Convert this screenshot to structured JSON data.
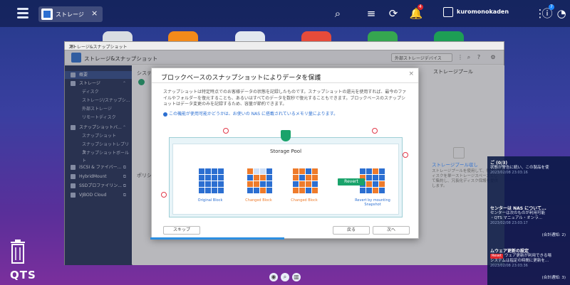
{
  "topbar": {
    "tab_label": "ストレージ",
    "user_name": "kuromonokaden",
    "notif_count": "4",
    "info_count": "7"
  },
  "dock": {
    "qts_label": "QTS"
  },
  "window": {
    "title": "ストレージ&スナップショット",
    "app_title": "ストレージ&スナップショット",
    "external_device": "外部ストレージデバイス"
  },
  "sidebar": {
    "items": [
      {
        "label": "概要",
        "level": "main"
      },
      {
        "label": "ストレージ",
        "level": "main"
      },
      {
        "label": "ディスク",
        "level": "sub"
      },
      {
        "label": "ストレージ/スナップシ...",
        "level": "sub"
      },
      {
        "label": "外部ストレージ",
        "level": "sub"
      },
      {
        "label": "リモートディスク",
        "level": "sub"
      },
      {
        "label": "スナップショットバ...",
        "level": "main"
      },
      {
        "label": "スナップショット",
        "level": "sub"
      },
      {
        "label": "スナップショットレプリカ",
        "level": "sub"
      },
      {
        "label": "スナップショットボールト",
        "level": "sub"
      },
      {
        "label": "iSCSI & ファイバー...",
        "level": "main"
      },
      {
        "label": "HybridMount",
        "level": "main"
      },
      {
        "label": "SSDプロファイリン...",
        "level": "main"
      },
      {
        "label": "VJBOD Cloud",
        "level": "main"
      }
    ]
  },
  "content": {
    "label_system": "システ",
    "label_policy": "ポリシ",
    "right_title": "ストレージプール",
    "right_link": "ストレージプール収し",
    "right_desc": "ストレージプールを使用して、物理ディスクを単一ストレージスペースとして集約し、冗長化ディスク保護を提供します。"
  },
  "dialog": {
    "title": "ブロックベースのスナップショットによりデータを保護",
    "description": "スナップショットは特定時点でのお客様データの状態を記録したものです。スナップショットの還元を使用すれば、最今のファイルやフォルダーを復元することも、あるいはすべてのデータを数秒で復元することもできます。ブロックベースのスナップショットはデータ変更のみを記録するため、容量が節約できます。",
    "note": "この機能が使用可能かどうかは、お使いの NAS に搭載されているメモリ量によります。",
    "pool_title": "Storage Pool",
    "labels": {
      "original": "Original Block",
      "changed1": "Changed Block",
      "changed2": "Changed Block",
      "revert_result": "Revert by mounting Snapshot",
      "revert_btn": "Revert"
    },
    "buttons": {
      "skip": "スキップ",
      "back": "戻る",
      "next": "次へ"
    }
  },
  "notifications": [
    {
      "title": "ご (0/3)",
      "body": "状態が警告に統い、この製品を使",
      "time": "2023/02/08 23:03:16",
      "badge": ""
    },
    {
      "title": "センターは NAS について...",
      "body": "センターは次のものが利用可能\n・QTS マニュアル・オンラ...",
      "time": "2023/02/08 23:03:17",
      "badge": "",
      "count": "(合計通知: 2)"
    },
    {
      "title": "ムウェア更新の設定",
      "body": "ウェア更新が利用できる場\nシステムは指定の時間に更新を...",
      "time": "2023/02/08 23:03:36",
      "badge": "Reset",
      "count": "(合計通知: 3)"
    }
  ],
  "colors": {
    "accent": "#2c6fd1",
    "green": "#1aa36b",
    "orange": "#ee7b2b",
    "sidebar": "#1f2d57",
    "alert": "#e0252b"
  }
}
